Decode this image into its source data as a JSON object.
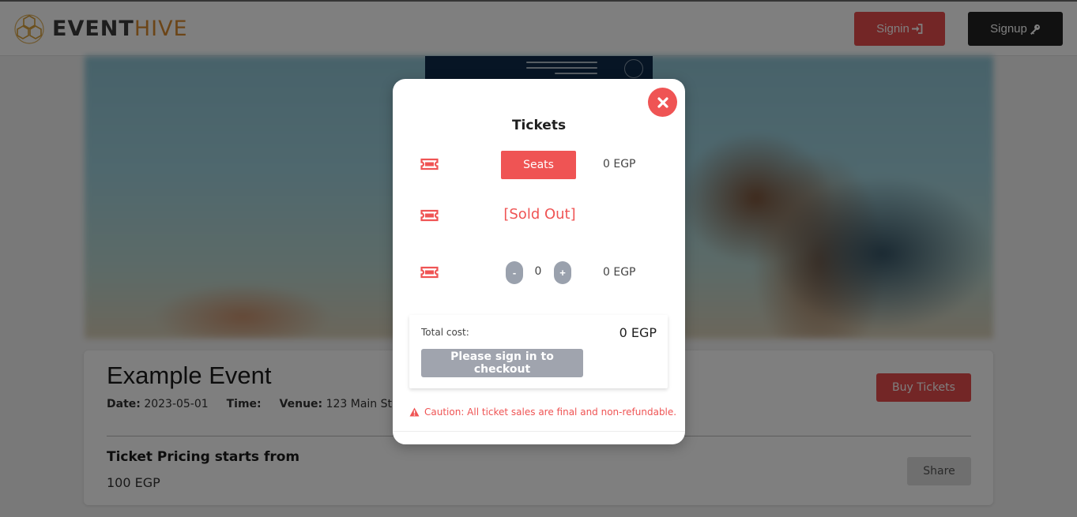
{
  "header": {
    "logo_event": "EVENT",
    "logo_hive": "HIVE",
    "signin_label": "Signin",
    "signup_label": "Signup"
  },
  "event": {
    "title": "Example Event",
    "date_label": "Date:",
    "date_value": "2023-05-01",
    "time_label": "Time:",
    "venue_label": "Venue:",
    "venue_value": "123 Main St, Anyto",
    "buy_label": "Buy Tickets",
    "pricing_label": "Ticket Pricing starts from",
    "pricing_value": "100 EGP",
    "share_label": "Share"
  },
  "modal": {
    "title": "Tickets",
    "rows": [
      {
        "action_label": "Seats",
        "price": "0 EGP"
      },
      {
        "status": "[Sold Out]"
      },
      {
        "minus": "-",
        "quantity": "0",
        "plus": "+",
        "price": "0 EGP"
      }
    ],
    "total_label": "Total cost:",
    "total_value": "0 EGP",
    "checkout_label": "Please sign in to checkout",
    "caution": "Caution: All ticket sales are final and non-refundable."
  },
  "colors": {
    "accent": "#ef5454",
    "brand_orange": "#d88a2f",
    "dark": "#222222",
    "disabled": "#a0a4ae"
  },
  "icons": {
    "logo": "honeycomb-icon",
    "signin": "sign-in-icon",
    "signup": "key-icon",
    "close": "close-icon",
    "ticket": "ticket-icon",
    "caution": "warning-icon"
  }
}
